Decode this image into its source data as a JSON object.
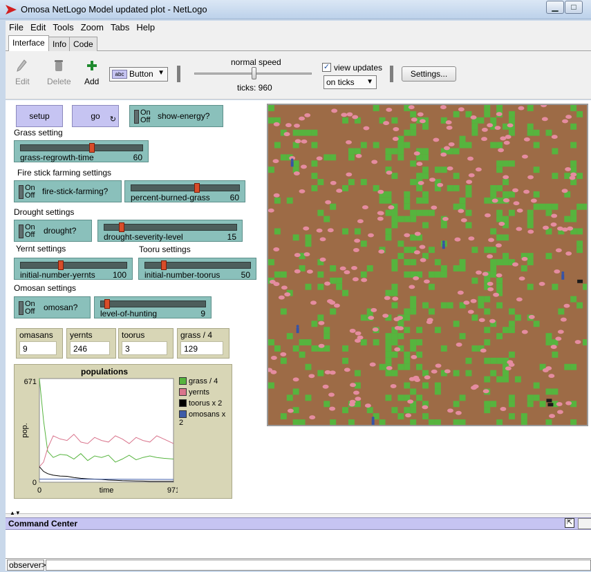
{
  "window": {
    "title": "Omosa NetLogo Model updated plot - NetLogo",
    "minimize": "▁",
    "maximize": "□"
  },
  "menu": [
    "File",
    "Edit",
    "Tools",
    "Zoom",
    "Tabs",
    "Help"
  ],
  "tabs": [
    "Interface",
    "Info",
    "Code"
  ],
  "toolbar": {
    "edit_label": "Edit",
    "delete_label": "Delete",
    "add_label": "Add",
    "widget_type": "Button",
    "speed_label": "normal speed",
    "speed_fraction": 0.49,
    "ticks_label": "ticks: 960",
    "view_updates_label": "view updates",
    "view_updates_checked": true,
    "update_mode": "on ticks",
    "settings_label": "Settings..."
  },
  "widgets": {
    "setup_label": "setup",
    "go_label": "go",
    "show_energy_label": "show-energy?",
    "grass_setting": "Grass setting",
    "grass_regrowth": {
      "label": "grass-regrowth-time",
      "value": "60",
      "fraction": 0.6
    },
    "fire_settings": "Fire stick farming settings",
    "fire_stick_label": "fire-stick-farming?",
    "percent_burned": {
      "label": "percent-burned-grass",
      "value": "60",
      "fraction": 0.6
    },
    "drought_settings": "Drought settings",
    "drought_label": "drought?",
    "drought_severity": {
      "label": "drought-severity-level",
      "value": "15",
      "fraction": 0.15
    },
    "yernt_settings": "Yernt settings",
    "tooru_settings": "Tooru settings",
    "initial_yernts": {
      "label": "initial-number-yernts",
      "value": "100",
      "fraction": 0.4
    },
    "initial_toorus": {
      "label": "initial-number-toorus",
      "value": "50",
      "fraction": 0.2
    },
    "omosan_settings": "Omosan settings",
    "omosan_label": "omosan?",
    "level_of_hunting": {
      "label": "level-of-hunting",
      "value": "9",
      "fraction": 0.09
    },
    "switch_on": "On",
    "switch_off": "Off"
  },
  "monitors": [
    {
      "label": "omasans",
      "value": "9"
    },
    {
      "label": "yernts",
      "value": "246"
    },
    {
      "label": "toorus",
      "value": "3"
    },
    {
      "label": "grass / 4",
      "value": "129"
    }
  ],
  "chart_data": {
    "type": "line",
    "title": "populations",
    "xlabel": "time",
    "ylabel": "pop.",
    "xlim": [
      0,
      971
    ],
    "ylim": [
      0,
      671
    ],
    "x_tick_labels": [
      "0",
      "971"
    ],
    "y_tick_labels": [
      "0",
      "671"
    ],
    "series": [
      {
        "name": "grass / 4",
        "color": "#56b43e",
        "x": [
          0,
          30,
          60,
          100,
          150,
          200,
          250,
          300,
          350,
          400,
          450,
          500,
          550,
          600,
          650,
          700,
          750,
          800,
          850,
          900,
          971
        ],
        "values": [
          671,
          400,
          200,
          160,
          180,
          175,
          150,
          185,
          140,
          170,
          160,
          175,
          130,
          150,
          175,
          145,
          160,
          170,
          160,
          155,
          150
        ]
      },
      {
        "name": "yernts",
        "color": "#d9748c",
        "x": [
          0,
          30,
          60,
          100,
          150,
          200,
          250,
          300,
          350,
          400,
          450,
          500,
          550,
          600,
          650,
          700,
          750,
          800,
          850,
          900,
          971
        ],
        "values": [
          100,
          130,
          220,
          300,
          280,
          270,
          310,
          260,
          250,
          290,
          270,
          260,
          300,
          280,
          250,
          290,
          270,
          260,
          300,
          280,
          250
        ]
      },
      {
        "name": "toorus x 2",
        "color": "#000000",
        "x": [
          0,
          30,
          60,
          100,
          150,
          200,
          250,
          300,
          350,
          400,
          450,
          500,
          550,
          600,
          650,
          700,
          750,
          800,
          850,
          900,
          971
        ],
        "values": [
          100,
          70,
          55,
          45,
          40,
          38,
          30,
          25,
          22,
          20,
          18,
          14,
          12,
          10,
          9,
          8,
          7,
          6,
          6,
          6,
          6
        ]
      },
      {
        "name": "omosans x 2",
        "color": "#3e5ca8",
        "x": [
          0,
          971
        ],
        "values": [
          20,
          18
        ]
      }
    ]
  },
  "world": {
    "ground_color": "#9d6b46",
    "grass_color": "#56b43e",
    "yernt_color": "#e58ca0",
    "omosan_color": "#3653a6",
    "tooru_color": "#1a1a1a"
  },
  "command_center": {
    "title": "Command Center",
    "prompt": "observer>"
  }
}
